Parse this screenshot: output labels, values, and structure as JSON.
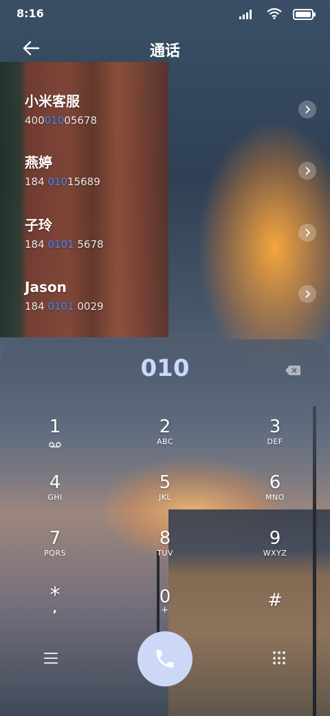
{
  "status": {
    "time": "8:16"
  },
  "header": {
    "title": "通话"
  },
  "contacts": [
    {
      "name": "小米客服",
      "num_pre": "400",
      "num_hl": "010",
      "num_post": "05678"
    },
    {
      "name": "燕婷",
      "num_pre": "184 ",
      "num_hl": "010",
      "num_post": "15689"
    },
    {
      "name": "子玲",
      "num_pre": "184 ",
      "num_hl": "0101",
      "num_post": " 5678"
    },
    {
      "name": "Jason",
      "num_pre": "184 ",
      "num_hl": "0101",
      "num_post": " 0029"
    }
  ],
  "dialpad": {
    "entered": "010",
    "keys": [
      {
        "num": "1",
        "sub": ""
      },
      {
        "num": "2",
        "sub": "ABC"
      },
      {
        "num": "3",
        "sub": "DEF"
      },
      {
        "num": "4",
        "sub": "GHI"
      },
      {
        "num": "5",
        "sub": "JKL"
      },
      {
        "num": "6",
        "sub": "MNO"
      },
      {
        "num": "7",
        "sub": "PQRS"
      },
      {
        "num": "8",
        "sub": "TUV"
      },
      {
        "num": "9",
        "sub": "WXYZ"
      },
      {
        "num": "*",
        "sub": ","
      },
      {
        "num": "0",
        "sub": "+"
      },
      {
        "num": "#",
        "sub": ""
      }
    ],
    "accent": "#3d8bff",
    "digits_color": "#c9d9ff",
    "call_button_color": "#cdd8f6"
  },
  "icons": [
    "back-arrow-icon",
    "signal-icon",
    "wifi-icon",
    "battery-icon",
    "chevron-right-icon",
    "backspace-icon",
    "voicemail-icon",
    "menu-icon",
    "phone-icon",
    "dialpad-grid-icon"
  ]
}
